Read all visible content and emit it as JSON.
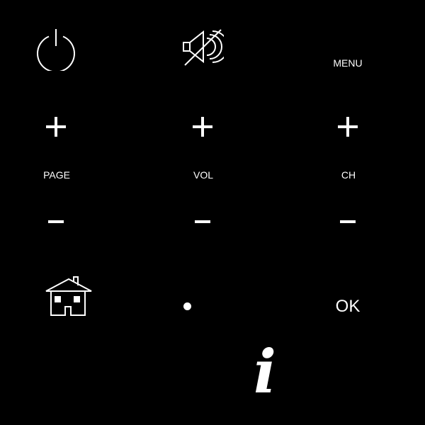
{
  "remote": {
    "top_row": {
      "power_icon": "power-icon",
      "mute_icon": "mute-icon",
      "menu_label": "MENU"
    },
    "page": {
      "plus_icon": "plus-icon",
      "label": "PAGE",
      "minus_icon": "minus-icon"
    },
    "vol": {
      "plus_icon": "plus-icon",
      "label": "VOL",
      "minus_icon": "minus-icon"
    },
    "ch": {
      "plus_icon": "plus-icon",
      "label": "CH",
      "minus_icon": "minus-icon"
    },
    "bottom_row": {
      "home_icon": "home-icon",
      "dot_icon": "dot-icon",
      "ok_label": "OK"
    },
    "info": {
      "glyph": "i",
      "icon": "info-icon"
    }
  },
  "colors": {
    "background": "#000000",
    "foreground": "#ffffff"
  }
}
